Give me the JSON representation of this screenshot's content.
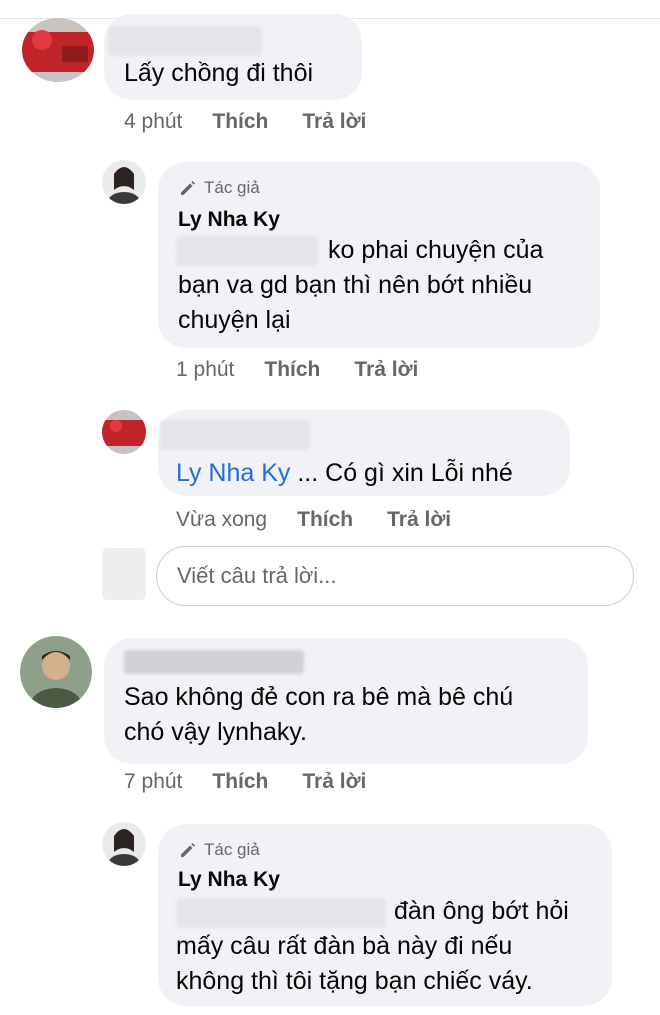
{
  "comments": [
    {
      "text": "Lấy chồng đi thôi",
      "time": "4 phút",
      "like": "Thích",
      "reply": "Trả lời",
      "replies": [
        {
          "author_tag": "Tác giả",
          "name": "Ly Nha Ky",
          "line1": "ko phai chuyện của",
          "line2": "bạn va gd bạn thì nên bớt nhiều",
          "line3": "chuyện lại",
          "time": "1 phút",
          "like": "Thích",
          "reply": "Trả lời"
        },
        {
          "mention": "Ly Nha Ky",
          "text": " ... Có gì xin Lỗi nhé",
          "time": "Vừa xong",
          "like": "Thích",
          "reply": "Trả lời"
        }
      ],
      "reply_input": {
        "placeholder": "Viết câu trả lời..."
      }
    },
    {
      "text_line1": "Sao không đẻ con ra bê mà bê chú",
      "text_line2": "chó vậy lynhaky.",
      "time": "7 phút",
      "like": "Thích",
      "reply": "Trả lời",
      "replies": [
        {
          "author_tag": "Tác giả",
          "name": "Ly Nha Ky",
          "line1": "đàn ông bớt hỏi",
          "line2": "mấy câu rất đàn bà này đi nếu",
          "line3": "không thì tôi tặng bạn chiếc váy."
        }
      ]
    }
  ],
  "colors": {
    "bubble": "#f0f2f5",
    "mention": "#216fdb",
    "meta": "#65676b",
    "text": "#050505"
  },
  "icons": {
    "author_tag": "pencil-icon"
  }
}
